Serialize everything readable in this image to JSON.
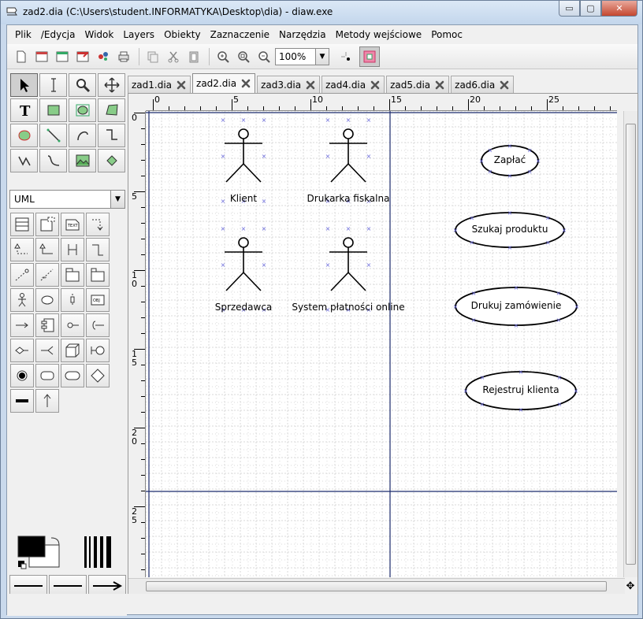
{
  "window": {
    "title": "zad2.dia (C:\\Users\\student.INFORMATYKA\\Desktop\\dia) - diaw.exe",
    "minimize": "▭",
    "maximize": "▢",
    "close": "✕"
  },
  "menu": [
    "Plik",
    "/Edycja",
    "Widok",
    "Layers",
    "Obiekty",
    "Zaznaczenie",
    "Narzędzia",
    "Metody wejściowe",
    "Pomoc"
  ],
  "toolbar": {
    "zoom": "100%"
  },
  "toolbox": {
    "sheet": "UML"
  },
  "tabs": [
    {
      "label": "zad1.dia",
      "active": false
    },
    {
      "label": "zad2.dia",
      "active": true
    },
    {
      "label": "zad3.dia",
      "active": false
    },
    {
      "label": "zad4.dia",
      "active": false
    },
    {
      "label": "zad5.dia",
      "active": false
    },
    {
      "label": "zad6.dia",
      "active": false
    }
  ],
  "rulers": {
    "horizontal": [
      "0",
      "5",
      "10",
      "15",
      "20",
      "25"
    ],
    "vertical": [
      "0",
      "5",
      "1\n0",
      "1\n5",
      "2\n0",
      "2\n5"
    ]
  },
  "diagram": {
    "actors": [
      {
        "name": "Klient"
      },
      {
        "name": "Drukarka fiskalna"
      },
      {
        "name": "Sprzedawca"
      },
      {
        "name": "System płatności online"
      }
    ],
    "use_cases": [
      {
        "name": "Zapłać"
      },
      {
        "name": "Szukaj produktu"
      },
      {
        "name": "Drukuj zamówienie"
      },
      {
        "name": "Rejestruj klienta"
      }
    ]
  },
  "colors": {
    "foreground": "#000000",
    "background": "#ffffff",
    "grid": "#d8d8d8",
    "page_border": "#1a2a6c"
  }
}
